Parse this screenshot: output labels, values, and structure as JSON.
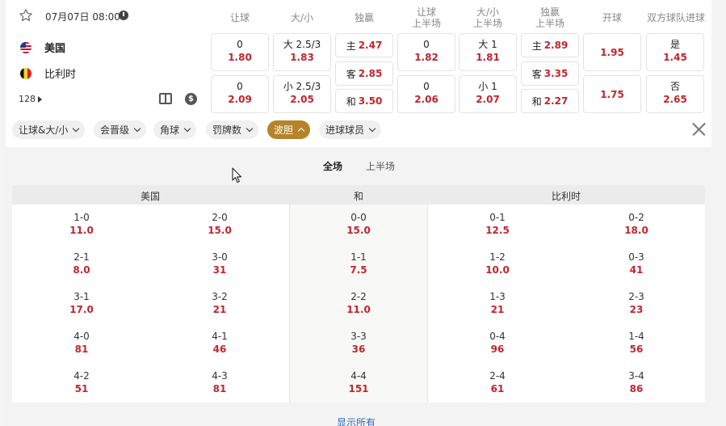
{
  "match": {
    "datetime": "07月07日 08:00",
    "home": "美国",
    "away": "比利时",
    "more_count": "128"
  },
  "columns": [
    "让球",
    "大/小",
    "独赢",
    "让球\n上半场",
    "大/小\n上半场",
    "独赢\n上半场",
    "开球",
    "双方球队进球"
  ],
  "odds": {
    "handicap": {
      "home_line": "0",
      "home_odds": "1.80",
      "away_line": "0",
      "away_odds": "2.09"
    },
    "over_under": {
      "over_line": "大 2.5/3",
      "over_odds": "1.83",
      "under_line": "小 2.5/3",
      "under_odds": "2.05"
    },
    "moneyline": {
      "home_label": "主",
      "home_odds": "2.47",
      "away_label": "客",
      "away_odds": "2.85",
      "draw_label": "和",
      "draw_odds": "3.50"
    },
    "handicap_1h": {
      "home_line": "0",
      "home_odds": "1.82",
      "away_line": "0",
      "away_odds": "2.06"
    },
    "over_under_1h": {
      "over_line": "大 1",
      "over_odds": "1.81",
      "under_line": "小 1",
      "under_odds": "2.07"
    },
    "moneyline_1h": {
      "home_label": "主",
      "home_odds": "2.89",
      "away_label": "客",
      "away_odds": "3.35",
      "draw_label": "和",
      "draw_odds": "2.27"
    },
    "kickoff": {
      "home_odds": "1.95",
      "away_odds": "1.75"
    },
    "btts": {
      "yes_label": "是",
      "yes_odds": "1.45",
      "no_label": "否",
      "no_odds": "2.65"
    }
  },
  "filters": [
    {
      "label": "让球&大/小",
      "active": false
    },
    {
      "label": "会晋级",
      "active": false
    },
    {
      "label": "角球",
      "active": false
    },
    {
      "label": "罚牌数",
      "active": false
    },
    {
      "label": "波胆",
      "active": true
    },
    {
      "label": "进球球员",
      "active": false
    }
  ],
  "periods": {
    "full": "全场",
    "first_half": "上半场"
  },
  "correct_score": {
    "headers": {
      "home": "美国",
      "draw": "和",
      "away": "比利时"
    },
    "home": [
      [
        "1-0",
        "11.0"
      ],
      [
        "2-0",
        "15.0"
      ],
      [
        "2-1",
        "8.0"
      ],
      [
        "3-0",
        "31"
      ],
      [
        "3-1",
        "17.0"
      ],
      [
        "3-2",
        "21"
      ],
      [
        "4-0",
        "81"
      ],
      [
        "4-1",
        "46"
      ],
      [
        "4-2",
        "51"
      ],
      [
        "4-3",
        "81"
      ]
    ],
    "draw": [
      [
        "0-0",
        "15.0"
      ],
      [
        "1-1",
        "7.5"
      ],
      [
        "2-2",
        "11.0"
      ],
      [
        "3-3",
        "36"
      ],
      [
        "4-4",
        "151"
      ]
    ],
    "away": [
      [
        "0-1",
        "12.5"
      ],
      [
        "0-2",
        "18.0"
      ],
      [
        "1-2",
        "10.0"
      ],
      [
        "0-3",
        "41"
      ],
      [
        "1-3",
        "21"
      ],
      [
        "2-3",
        "23"
      ],
      [
        "0-4",
        "96"
      ],
      [
        "1-4",
        "56"
      ],
      [
        "2-4",
        "61"
      ],
      [
        "3-4",
        "86"
      ]
    ]
  },
  "show_all": "显示所有"
}
